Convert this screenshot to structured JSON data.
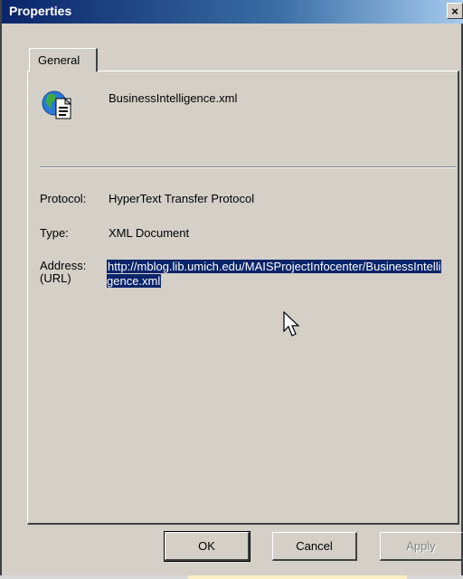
{
  "window": {
    "title": "Properties",
    "close_glyph": "×"
  },
  "tabs": [
    {
      "label": "General",
      "selected": true
    }
  ],
  "file": {
    "name": "BusinessIntelligence.xml",
    "icon": "xml-document-icon"
  },
  "properties": {
    "protocol_label": "Protocol:",
    "protocol_value": "HyperText Transfer Protocol",
    "type_label": "Type:",
    "type_value": "XML Document",
    "address_label_line1": "Address:",
    "address_label_line2": "(URL)",
    "address_value": "http://mblog.lib.umich.edu/MAISProjectInfocenter/BusinessIntelligence.xml"
  },
  "buttons": {
    "ok": "OK",
    "cancel": "Cancel",
    "apply": "Apply"
  },
  "colors": {
    "title_bar": "#0a246a",
    "dialog_face": "#d4d0c8",
    "selection": "#0a246a"
  }
}
